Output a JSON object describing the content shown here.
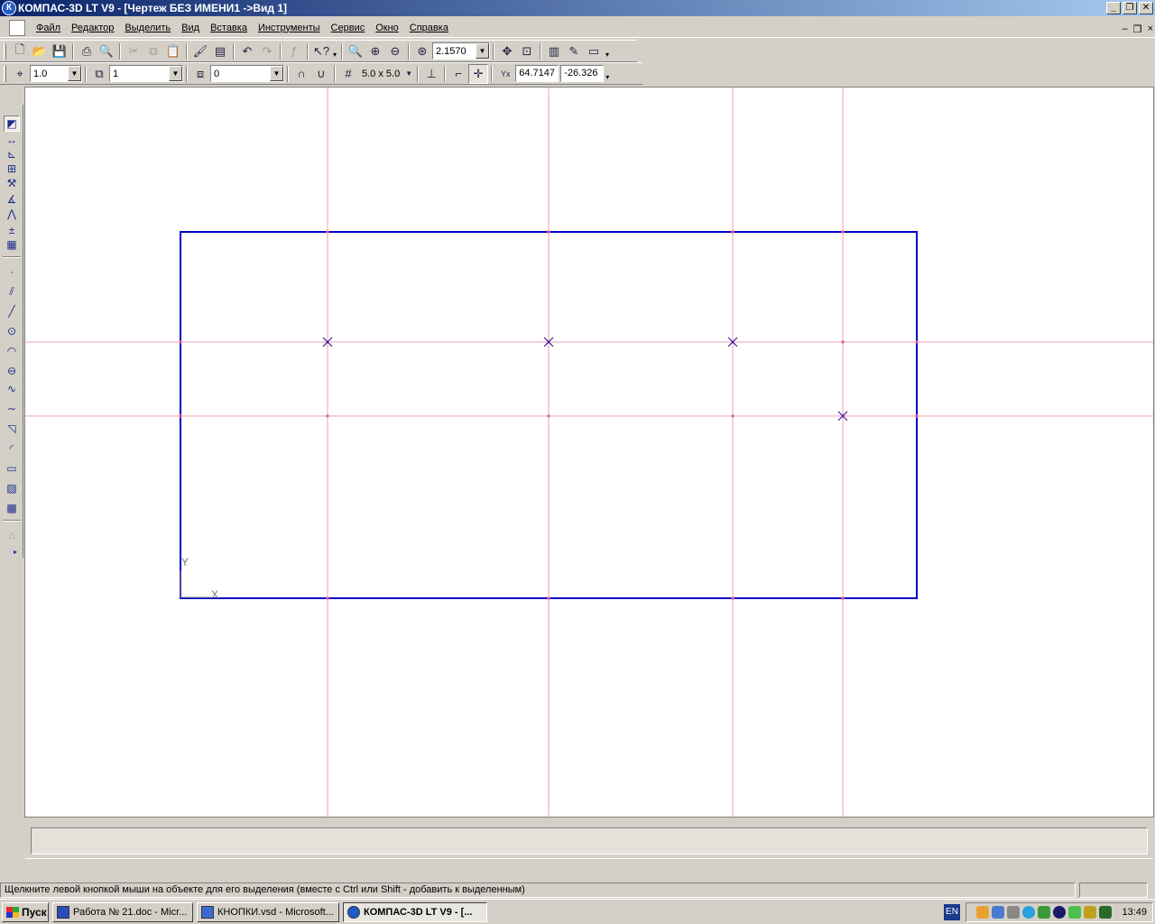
{
  "window": {
    "title": "КОМПАС-3D LT V9 - [Чертеж БЕЗ ИМЕНИ1 ->Вид 1]",
    "logo_text": "К",
    "minimize": "_",
    "restore": "❐",
    "close": "✕"
  },
  "menu": {
    "items": [
      "Файл",
      "Редактор",
      "Выделить",
      "Вид",
      "Вставка",
      "Инструменты",
      "Сервис",
      "Окно",
      "Справка"
    ],
    "mdi_minimize": "–",
    "mdi_restore": "❐",
    "mdi_close": "×"
  },
  "toolbar_standard": {
    "zoom_value": "2.1570"
  },
  "toolbar_current_state": {
    "step_value": "1.0",
    "state_value": "1",
    "layer_value": "0",
    "grid_value": "5.0 x 5.0",
    "coord_x": "64.7147",
    "coord_y": "-26.326"
  },
  "drawing": {
    "axis_y_label": "Y",
    "axis_x_label": "X",
    "stroke_color": "#0000c8",
    "aux_color": "#e8a0b8",
    "point_color": "#3a1fa0"
  },
  "status": {
    "message": "Щелкните левой кнопкой мыши на объекте для его выделения (вместе с Ctrl или Shift - добавить к выделенным)"
  },
  "taskbar": {
    "start_label": "Пуск",
    "tasks": [
      {
        "label": "Работа № 21.doc - Micr..."
      },
      {
        "label": "КНОПКИ.vsd - Microsoft..."
      },
      {
        "label": "КОМПАС-3D LT V9 - [..."
      }
    ],
    "lang": "EN",
    "clock": "13:49"
  }
}
